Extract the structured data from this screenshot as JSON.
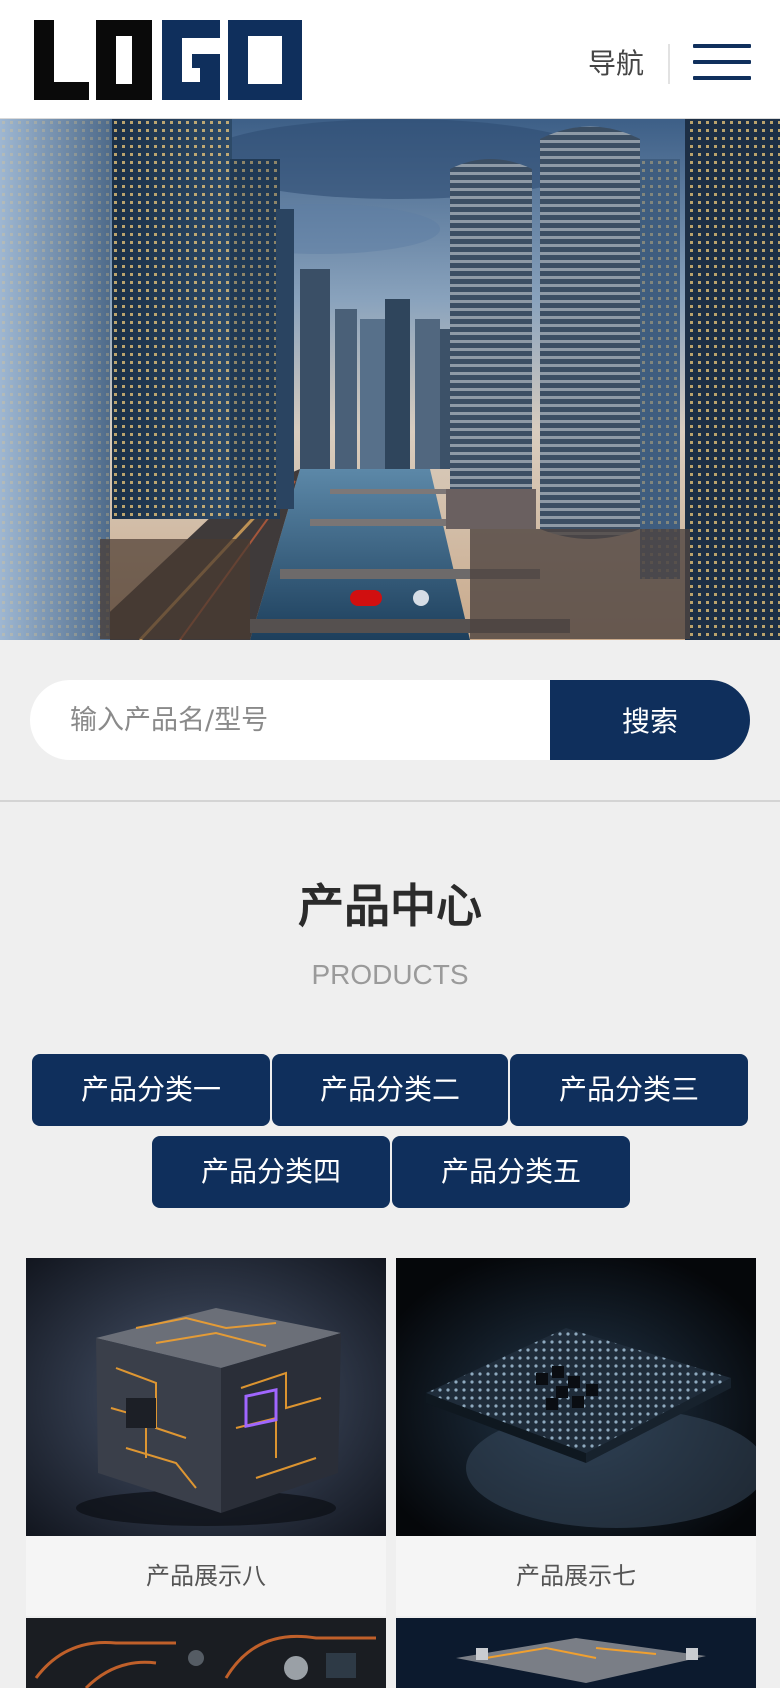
{
  "header": {
    "logo_text": "LOGO",
    "nav_label": "导航",
    "menu_icon": "hamburger-menu-icon",
    "brand_color": "#0f2f5c"
  },
  "banner": {
    "slide_count": 2,
    "active_slide": 1,
    "active_dot_color": "#d10f10"
  },
  "search": {
    "placeholder": "输入产品名/型号",
    "button_label": "搜索"
  },
  "products_section": {
    "title": "产品中心",
    "subtitle": "PRODUCTS",
    "categories": [
      "产品分类一",
      "产品分类二",
      "产品分类三",
      "产品分类四",
      "产品分类五"
    ],
    "items": [
      {
        "name": "产品展示八"
      },
      {
        "name": "产品展示七"
      }
    ]
  }
}
